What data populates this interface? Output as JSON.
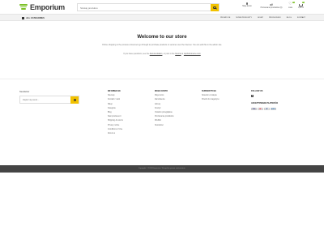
{
  "brand": {
    "name": "Emporium",
    "accent": "#7cc128",
    "button": "#f2c200"
  },
  "search": {
    "placeholder": "Szukaj produktu"
  },
  "header_icons": [
    {
      "name": "user-icon",
      "label": "Moje konto"
    },
    {
      "name": "compare-icon",
      "label": "Porównanie produktów (0)"
    },
    {
      "name": "wishlist-icon",
      "label": "Lista",
      "count": "0"
    },
    {
      "name": "cart-icon",
      "label": "0,00 zł",
      "count": "0"
    }
  ],
  "nav": {
    "all_categories": "ALL CATEGORIES",
    "links": [
      "Promocje",
      "Nowe produkty",
      "Sklep",
      "Producenci",
      "Blog",
      "Kontakt"
    ]
  },
  "main": {
    "title": "Welcome to our store",
    "intro": "Online shopping is the process consumers go through to purchase products or services over the Internet. You can edit this in the admin site.",
    "intro2_prefix": "If you have questions, see the",
    "intro2_link1": "documentation",
    "intro2_mid": ", or post in the",
    "intro2_link2": "forums",
    "intro2_mid2": "at",
    "intro2_link3": "nopCommerce.com"
  },
  "footer": {
    "newsletter_title": "Newsletter",
    "newsletter_placeholder": "Zapisz się teraz...",
    "col1": {
      "title": "Informacje",
      "links": [
        "Sitemap",
        "Kontakt z nami",
        "Sklep",
        "Kategorie",
        "Blog",
        "Nasi producenci",
        "Shipping & returns",
        "Privacy notice",
        "Conditions of Use",
        "About us"
      ]
    },
    "col2": {
      "title": "Moje konto",
      "links": [
        "Moje konto",
        "Zamówienia",
        "Adresy",
        "Koszyk",
        "Ostatnio przeglądane",
        "Porównanie produktów",
        "Wishlist",
        "Newsletter"
      ]
    },
    "col3": {
      "title": "Subskrypcje",
      "links": [
        "Nowości w sklepie",
        "Powrót do magazynu"
      ]
    },
    "col4": {
      "title": "Follow us",
      "social_icon": "f",
      "payments_title": "Akceptowane płatności",
      "payments": [
        "VISA",
        "MC",
        "PP",
        "AMEX"
      ]
    }
  },
  "copyright": "Copyright © 2024 Emporium. Wszystkie prawa zastrzeżone."
}
